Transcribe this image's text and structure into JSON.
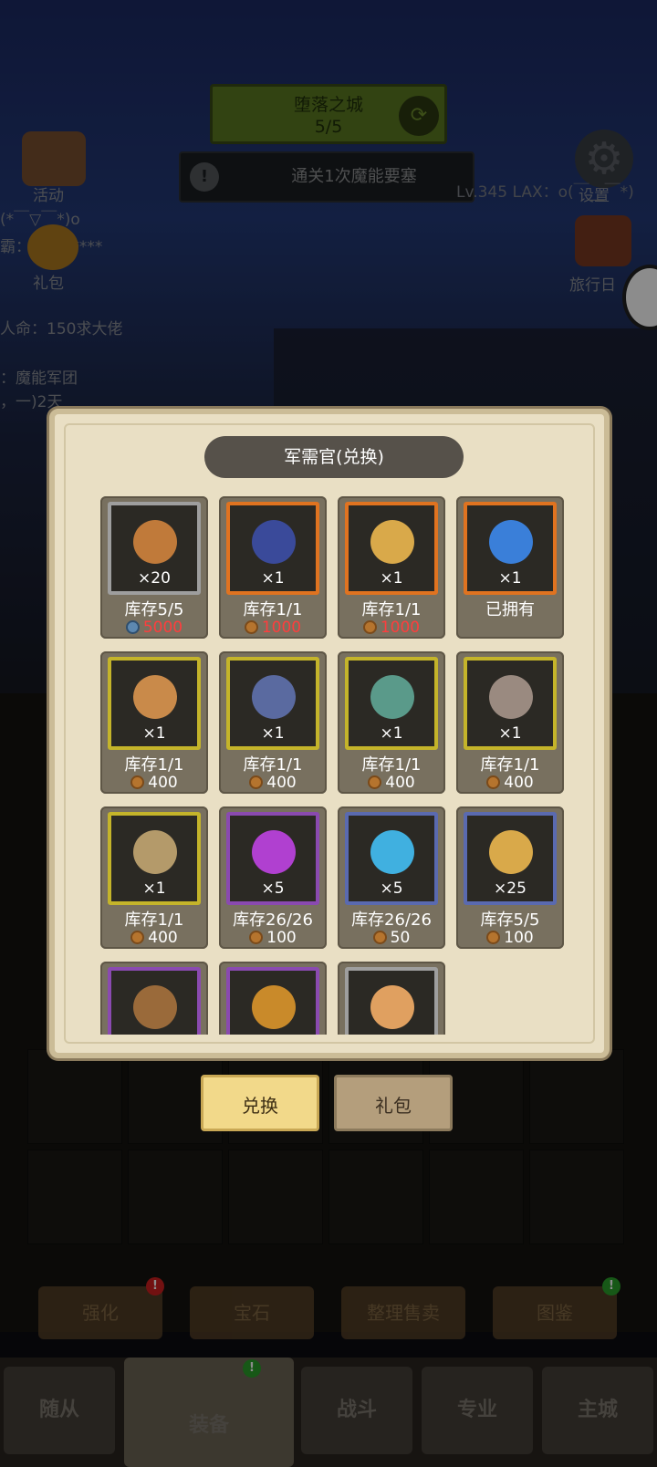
{
  "top": {
    "stage_title": "堕落之城",
    "stage_progress": "5/5",
    "quest_text": "通关1次魔能要塞",
    "level_text": "Lv.345 LAX：o(￣__￣*)"
  },
  "side": {
    "activity": "活动",
    "gift": "礼包",
    "emote": "(*￣▽￣*)o",
    "name_line": "霸：LOVE****",
    "chat_line": "人命：150求大佬",
    "guild_line": "：魔能军团",
    "days_line": "，一)2天",
    "settings": "设置",
    "travel": "旅行日"
  },
  "panel": {
    "title": "军需官(兑换)",
    "items": [
      {
        "qty": "×20",
        "stock": "库存5/5",
        "price": "5000",
        "currency": "diamond",
        "icon": "bronze-shield-icon",
        "frame": "#9e9e9e",
        "color": "#c07a3a",
        "price_red": true
      },
      {
        "qty": "×1",
        "stock": "库存1/1",
        "price": "1000",
        "currency": "coin",
        "icon": "sapphire-amulet-icon",
        "frame": "#e07320",
        "color": "#3a4a9a",
        "price_red": true
      },
      {
        "qty": "×1",
        "stock": "库存1/1",
        "price": "1000",
        "currency": "coin",
        "icon": "horn-icon",
        "frame": "#e07320",
        "color": "#d9a94a",
        "price_red": true
      },
      {
        "qty": "×1",
        "stock": "已拥有",
        "price": "",
        "currency": "",
        "icon": "blue-crystal-crown-icon",
        "frame": "#e07320",
        "color": "#3a7fd9",
        "price_red": false
      },
      {
        "qty": "×1",
        "stock": "库存1/1",
        "price": "400",
        "currency": "coin",
        "icon": "gear-skull-icon",
        "frame": "#c4b42a",
        "color": "#c98a4a",
        "price_red": false
      },
      {
        "qty": "×1",
        "stock": "库存1/1",
        "price": "400",
        "currency": "coin",
        "icon": "dagger-icon",
        "frame": "#c4b42a",
        "color": "#5a6aa0",
        "price_red": false
      },
      {
        "qty": "×1",
        "stock": "库存1/1",
        "price": "400",
        "currency": "coin",
        "icon": "arrow-icon",
        "frame": "#c4b42a",
        "color": "#5a9a8a",
        "price_red": false
      },
      {
        "qty": "×1",
        "stock": "库存1/1",
        "price": "400",
        "currency": "coin",
        "icon": "skull-badge-icon",
        "frame": "#c4b42a",
        "color": "#9a8a80",
        "price_red": false
      },
      {
        "qty": "×1",
        "stock": "库存1/1",
        "price": "400",
        "currency": "coin",
        "icon": "monster-helmet-icon",
        "frame": "#c4b42a",
        "color": "#b49a6a",
        "price_red": false
      },
      {
        "qty": "×5",
        "stock": "库存26/26",
        "price": "100",
        "currency": "coin",
        "icon": "dark-mask-icon",
        "frame": "#8a4ab0",
        "color": "#b040d0",
        "price_red": false
      },
      {
        "qty": "×5",
        "stock": "库存26/26",
        "price": "50",
        "currency": "coin",
        "icon": "ghost-card-icon",
        "frame": "#5a6ab0",
        "color": "#40b0e0",
        "price_red": false
      },
      {
        "qty": "×25",
        "stock": "库存5/5",
        "price": "100",
        "currency": "coin",
        "icon": "larva-icon",
        "frame": "#5a6ab0",
        "color": "#d9a94a",
        "price_red": false
      },
      {
        "qty": "",
        "stock": "",
        "price": "",
        "currency": "",
        "icon": "pickaxe-icon",
        "frame": "#8a4ab0",
        "color": "#9a6a3a",
        "price_red": false
      },
      {
        "qty": "",
        "stock": "",
        "price": "",
        "currency": "",
        "icon": "book-icon",
        "frame": "#8a4ab0",
        "color": "#c98a2a",
        "price_red": false
      },
      {
        "qty": "",
        "stock": "",
        "price": "",
        "currency": "",
        "icon": "scroll-icon",
        "frame": "#9e9e9e",
        "color": "#e0a060",
        "price_red": false
      }
    ]
  },
  "tabs": {
    "exchange": "兑换",
    "gift": "礼包"
  },
  "actions": {
    "enhance": "强化",
    "gem": "宝石",
    "sort_sell": "整理售卖",
    "codex": "图鉴"
  },
  "nav": {
    "follower": "随从",
    "equip": "装备",
    "battle": "战斗",
    "profession": "专业",
    "main_city": "主城"
  }
}
